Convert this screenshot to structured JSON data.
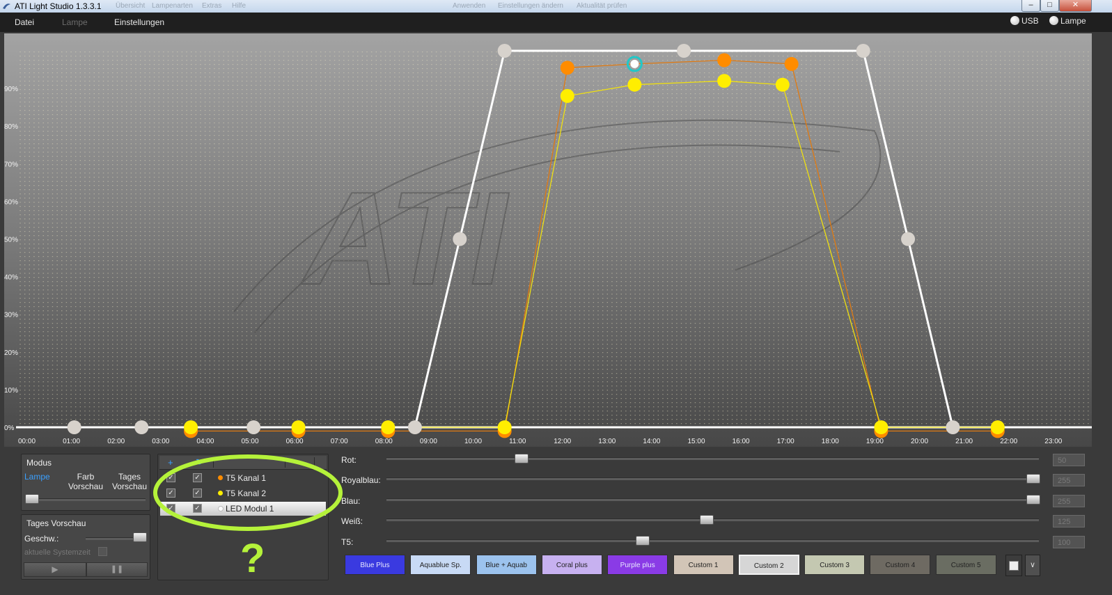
{
  "window": {
    "title": "ATI Light Studio 1.3.3.1",
    "faded_menu": [
      "Übersicht",
      "Lampenarten",
      "Extras",
      "Hilfe"
    ],
    "faded_center": [
      "Anwenden",
      "Einstellungen ändern",
      "Aktualität prüfen"
    ],
    "controls": {
      "minimize": "–",
      "maximize": "□",
      "close": "✕"
    }
  },
  "menubar": {
    "file": "Datei",
    "lamp": "Lampe",
    "settings": "Einstellungen",
    "usb_label": "USB",
    "lamp_label": "Lampe"
  },
  "chart_data": {
    "type": "line",
    "x_unit": "time of day (hours)",
    "xlim": [
      0,
      24
    ],
    "ylim": [
      0,
      100
    ],
    "x_ticks": [
      "00:00",
      "01:00",
      "02:00",
      "03:00",
      "04:00",
      "05:00",
      "06:00",
      "07:00",
      "08:00",
      "09:00",
      "10:00",
      "11:00",
      "12:00",
      "13:00",
      "14:00",
      "15:00",
      "16:00",
      "17:00",
      "18:00",
      "19:00",
      "20:00",
      "21:00",
      "22:00",
      "23:00"
    ],
    "y_ticks": [
      "0%",
      "10%",
      "20%",
      "30%",
      "40%",
      "50%",
      "60%",
      "70%",
      "80%",
      "90%"
    ],
    "watermark": "ATI",
    "series": [
      {
        "color": "#ffffff",
        "points": [
          [
            1.3,
            0
          ],
          [
            2.8,
            0
          ],
          [
            5.3,
            0
          ],
          [
            8.9,
            0
          ],
          [
            9.9,
            50
          ],
          [
            10.9,
            100
          ],
          [
            14.9,
            100
          ],
          [
            18.9,
            100
          ],
          [
            19.9,
            50
          ],
          [
            20.9,
            0
          ]
        ]
      },
      {
        "color": "#ff8c00",
        "points": [
          [
            3.9,
            -1
          ],
          [
            6.3,
            -1
          ],
          [
            8.3,
            -1
          ],
          [
            10.9,
            -1
          ],
          [
            12.3,
            95.5
          ],
          [
            13.8,
            96.5
          ],
          [
            15.8,
            97.5
          ],
          [
            17.3,
            96.5
          ],
          [
            19.3,
            -1
          ],
          [
            21.9,
            -1
          ]
        ],
        "selected_index": 5
      },
      {
        "color": "#ffee00",
        "points": [
          [
            3.9,
            0
          ],
          [
            6.3,
            0
          ],
          [
            8.3,
            0
          ],
          [
            10.9,
            0
          ],
          [
            12.3,
            88
          ],
          [
            13.8,
            91
          ],
          [
            15.8,
            92
          ],
          [
            17.1,
            91
          ],
          [
            19.3,
            0
          ],
          [
            21.9,
            0
          ]
        ]
      }
    ]
  },
  "modus": {
    "title": "Modus",
    "lamp": "Lampe",
    "farb_vorschau": [
      "Farb",
      "Vorschau"
    ],
    "tages_vorschau": [
      "Tages",
      "Vorschau"
    ],
    "slider_value": 0
  },
  "tages_vorschau_panel": {
    "title": "Tages Vorschau",
    "speed_label": "Geschw.:",
    "speed_value": 1.0,
    "system_time": "aktuelle Systemzeit",
    "play": "▶",
    "pause": "❚❚"
  },
  "channels": [
    {
      "name": "T5 Kanal 1",
      "color": "#ff8c00",
      "checked1": true,
      "checked2": true,
      "selected": false
    },
    {
      "name": "T5 Kanal 2",
      "color": "#ffee00",
      "checked1": true,
      "checked2": true,
      "selected": false
    },
    {
      "name": "LED Modul 1",
      "color": "#ffffff",
      "checked1": true,
      "checked2": true,
      "selected": true
    }
  ],
  "channel_header_icons": [
    "plus-icon",
    "refresh-icon"
  ],
  "annotation": "?",
  "color_sliders": [
    {
      "label": "Rot:",
      "value": "50",
      "fraction": 0.2
    },
    {
      "label": "Royalblau:",
      "value": "255",
      "fraction": 1.0
    },
    {
      "label": "Blau:",
      "value": "255",
      "fraction": 1.0
    },
    {
      "label": "Weiß:",
      "value": "125",
      "fraction": 0.49
    },
    {
      "label": "T5:",
      "value": "100",
      "fraction": 0.39
    }
  ],
  "presets": [
    {
      "label": "Blue Plus",
      "color": "#3a3ae0"
    },
    {
      "label": "Aquablue Sp.",
      "color": "#c8daf5"
    },
    {
      "label": "Blue + Aquab",
      "color": "#9cc3ee"
    },
    {
      "label": "Coral plus",
      "color": "#c7b1f0"
    },
    {
      "label": "Purple plus",
      "color": "#8a3be6"
    },
    {
      "label": "Custom 1",
      "color": "#d2c5b7"
    },
    {
      "label": "Custom 2",
      "color": "#d6d6d6"
    },
    {
      "label": "Custom 3",
      "color": "#c4c8b1"
    },
    {
      "label": "Custom 4",
      "color": "#6e6a62"
    },
    {
      "label": "Custom 5",
      "color": "#6a6d62"
    }
  ]
}
